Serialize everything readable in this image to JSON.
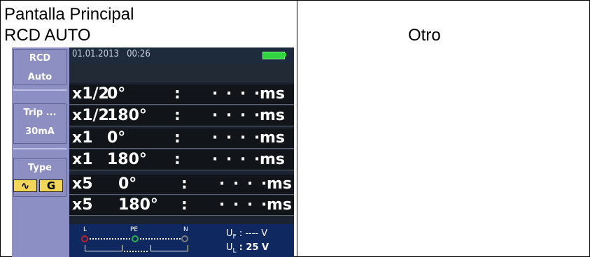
{
  "header": {
    "title": "Pantalla Principal",
    "subtitle": "RCD AUTO",
    "other": "Otro"
  },
  "sidebar": {
    "function": {
      "line1": "RCD",
      "line2": "Auto"
    },
    "trip": {
      "line1": "Trip ...",
      "line2": "30mA"
    },
    "type": {
      "label": "Type",
      "icon1": "∿",
      "icon2": "G"
    }
  },
  "status": {
    "date": "01.01.2013",
    "time": "00:26",
    "battery_icon": "battery-icon",
    "battery_color": "#2fd43e"
  },
  "results": [
    {
      "mult": "x1/2",
      "angle": "0°",
      "colon": ":",
      "value": "· · · ·",
      "unit": "ms"
    },
    {
      "mult": "x1/2",
      "angle": "180°",
      "colon": ":",
      "value": "· · · ·",
      "unit": "ms"
    },
    {
      "mult": "x1",
      "angle": "0°",
      "colon": ":",
      "value": "· · · ·",
      "unit": "ms"
    },
    {
      "mult": "x1",
      "angle": "180°",
      "colon": ":",
      "value": "· · · ·",
      "unit": "ms"
    },
    {
      "mult": "x5",
      "angle": "0°",
      "colon": ":",
      "value": "· · · ·",
      "unit": "ms"
    },
    {
      "mult": "x5",
      "angle": "180°",
      "colon": ":",
      "value": "· · · ·",
      "unit": "ms"
    }
  ],
  "terminals": {
    "L": "L",
    "PE": "PE",
    "N": "N",
    "colors": {
      "L": "#c0202a",
      "PE": "#2bb34a",
      "N": "#7a7a7a"
    }
  },
  "readings": {
    "uf": "U",
    "uf_sub": "F",
    "uf_value": ": ---- V",
    "ul": "U",
    "ul_sub": "L",
    "ul_value": ": 25 V"
  }
}
